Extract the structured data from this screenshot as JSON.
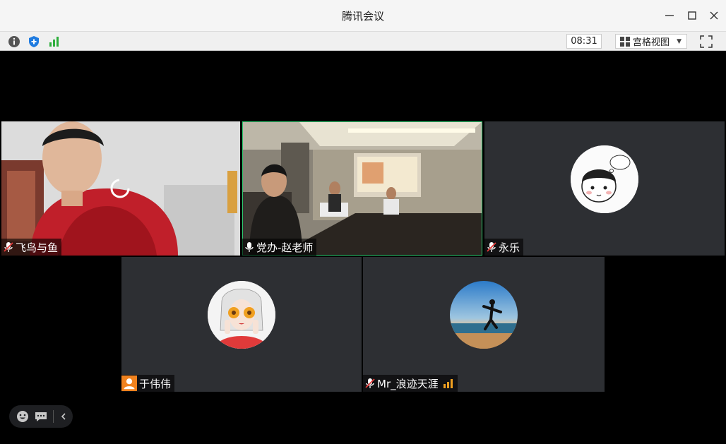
{
  "window": {
    "title": "腾讯会议"
  },
  "toolbar": {
    "clock": "08:31",
    "view_label": "宫格视图"
  },
  "participants": [
    {
      "name": "飞鸟与鱼",
      "mic": "muted"
    },
    {
      "name": "党办-赵老师",
      "mic": "on",
      "active": true
    },
    {
      "name": "永乐",
      "mic": "muted"
    },
    {
      "name": "于伟伟",
      "mic": "none"
    },
    {
      "name": "Mr_浪迹天涯",
      "mic": "muted"
    }
  ],
  "colors": {
    "tile_bg": "#2d2f33",
    "active_border": "#2ecc71",
    "signal_green": "#2eae3c",
    "shield_blue": "#1e7be0",
    "avatar_orange": "#f0821e"
  }
}
